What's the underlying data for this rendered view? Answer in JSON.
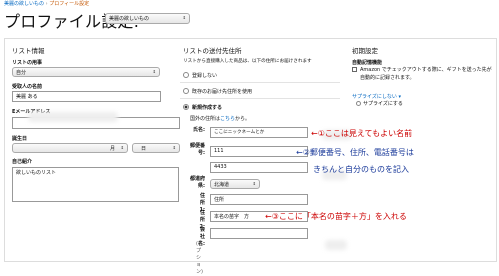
{
  "breadcrumb": {
    "parent": "美麗の欲しいもの",
    "sep": "›",
    "current": "プロフィール設定"
  },
  "header": {
    "title": "プロファイル設定:",
    "list_select": "美麗の欲しいもの",
    "caret": "⇕"
  },
  "list_info": {
    "heading": "リスト情報",
    "purpose_label": "リストの用事",
    "purpose_value": "自分",
    "recipient_label": "受取人の名前",
    "recipient_value": "美麗 ある",
    "email_label": "Eメールアドレス",
    "birthday_label": "誕生日",
    "month_value": "月",
    "day_value": "日",
    "intro_label": "自己紹介",
    "intro_value": "欲しいものリスト"
  },
  "shipping": {
    "heading": "リストの送付先住所",
    "note": "リストから直接購入した商品は、以下の住所にお届けされます",
    "option_none": "登録しない",
    "option_existing": "既存のお届け先住所を使用",
    "option_new": "新規作成する",
    "overseas_prefix": "国外の住所は",
    "overseas_link": "こちら",
    "overseas_suffix": "から。",
    "name_label": "氏名:",
    "name_value": "ここにニックネームとか",
    "zip_label": "郵便番号:",
    "zip_value": "111",
    "zip_value2": "4433",
    "pref_label": "都道府県:",
    "pref_value": "北海道",
    "addr1_label": "住所1:",
    "addr1_value": "住所",
    "addr2_label": "住所2:",
    "addr2_value": "本名の苗字　方",
    "company_label": "会社名:",
    "company_paren": "(オプション)"
  },
  "annotations": {
    "a1": "←①ここは見えてもよい名前",
    "a2": "←②郵便番号、住所、電話番号は",
    "a2b": "きちんと自分のものを記入",
    "a3": "←③ここに「本名の苗字＋方」を入れる"
  },
  "initial": {
    "heading": "初期設定",
    "auto_label": "自動記憶機能",
    "auto_text": "Amazon でチェックアウトする際に、ギフトを送った先が自動的に記録されます。",
    "surprise_link": "サプライズにしない",
    "surprise_caret": "▾",
    "surprise_sub": "サプライズにする"
  },
  "colors": {
    "annotation_red": "#cc0000",
    "annotation_blue": "#1a3a9a",
    "link": "#0066c0"
  }
}
